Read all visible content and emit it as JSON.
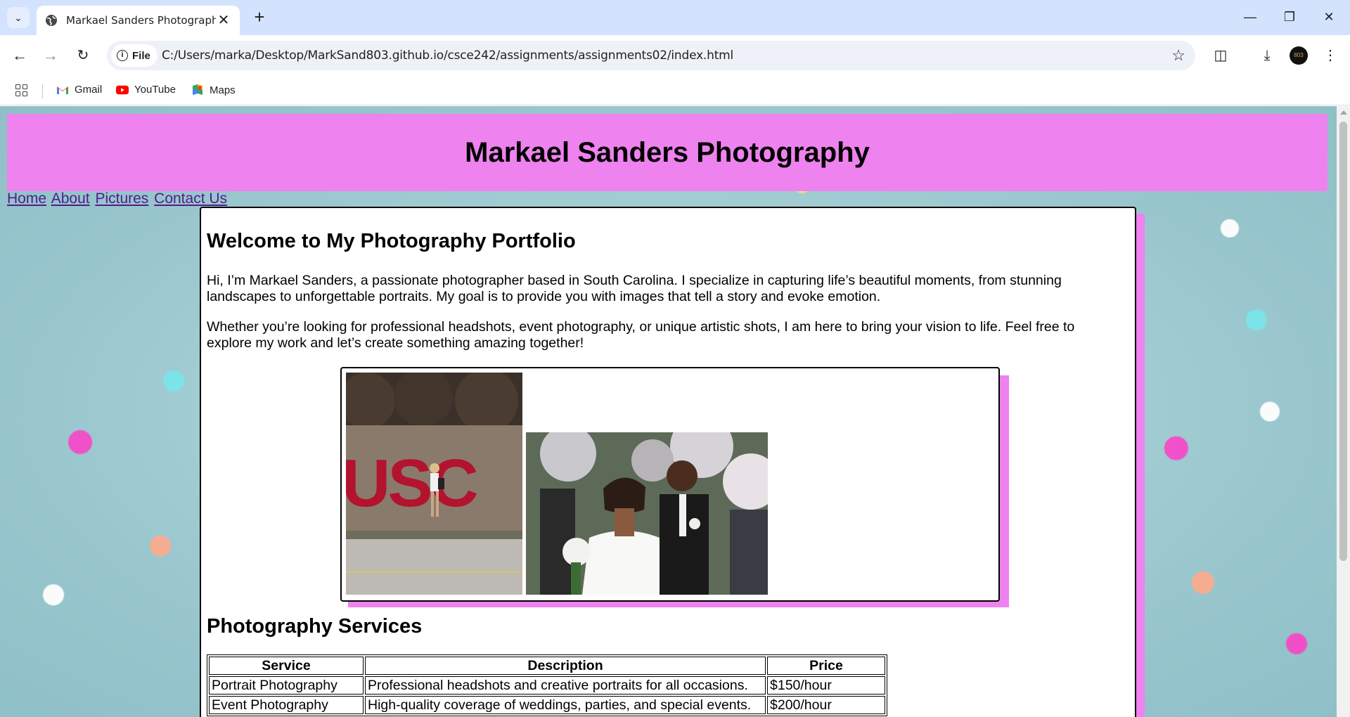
{
  "browser": {
    "tab_title": "Markael Sanders Photography",
    "site_chip_label": "File",
    "url": "C:/Users/marka/Desktop/MarkSand803.github.io/csce242/assignments/assignments02/index.html",
    "avatar_text": "803",
    "bookmarks": [
      {
        "label": "Gmail",
        "icon": "gmail-icon"
      },
      {
        "label": "YouTube",
        "icon": "youtube-icon"
      },
      {
        "label": "Maps",
        "icon": "maps-icon"
      }
    ]
  },
  "page": {
    "header_title": "Markael Sanders Photography",
    "nav": [
      "Home",
      "About",
      "Pictures",
      "Contact Us"
    ],
    "welcome_heading": "Welcome to My Photography Portfolio",
    "paragraph1": "Hi, I’m Markael Sanders, a passionate photographer based in South Carolina. I specialize in capturing life’s beautiful moments, from stunning landscapes to unforgettable portraits. My goal is to provide you with images that tell a story and evoke emotion.",
    "paragraph2": "Whether you’re looking for professional headshots, event photography, or unique artistic shots, I am here to bring your vision to life. Feel free to explore my work and let’s create something amazing together!",
    "usc_letters": "USC",
    "services_heading": "Photography Services",
    "services_table": {
      "headers": [
        "Service",
        "Description",
        "Price"
      ],
      "rows": [
        [
          "Portrait Photography",
          "Professional headshots and creative portraits for all occasions.",
          "$150/hour"
        ],
        [
          "Event Photography",
          "High-quality coverage of weddings, parties, and special events.",
          "$200/hour"
        ]
      ]
    }
  },
  "colors": {
    "header_bg": "#ee82ee",
    "link_visited": "#551a8b",
    "chrome_tabstrip": "#d3e3fd"
  }
}
